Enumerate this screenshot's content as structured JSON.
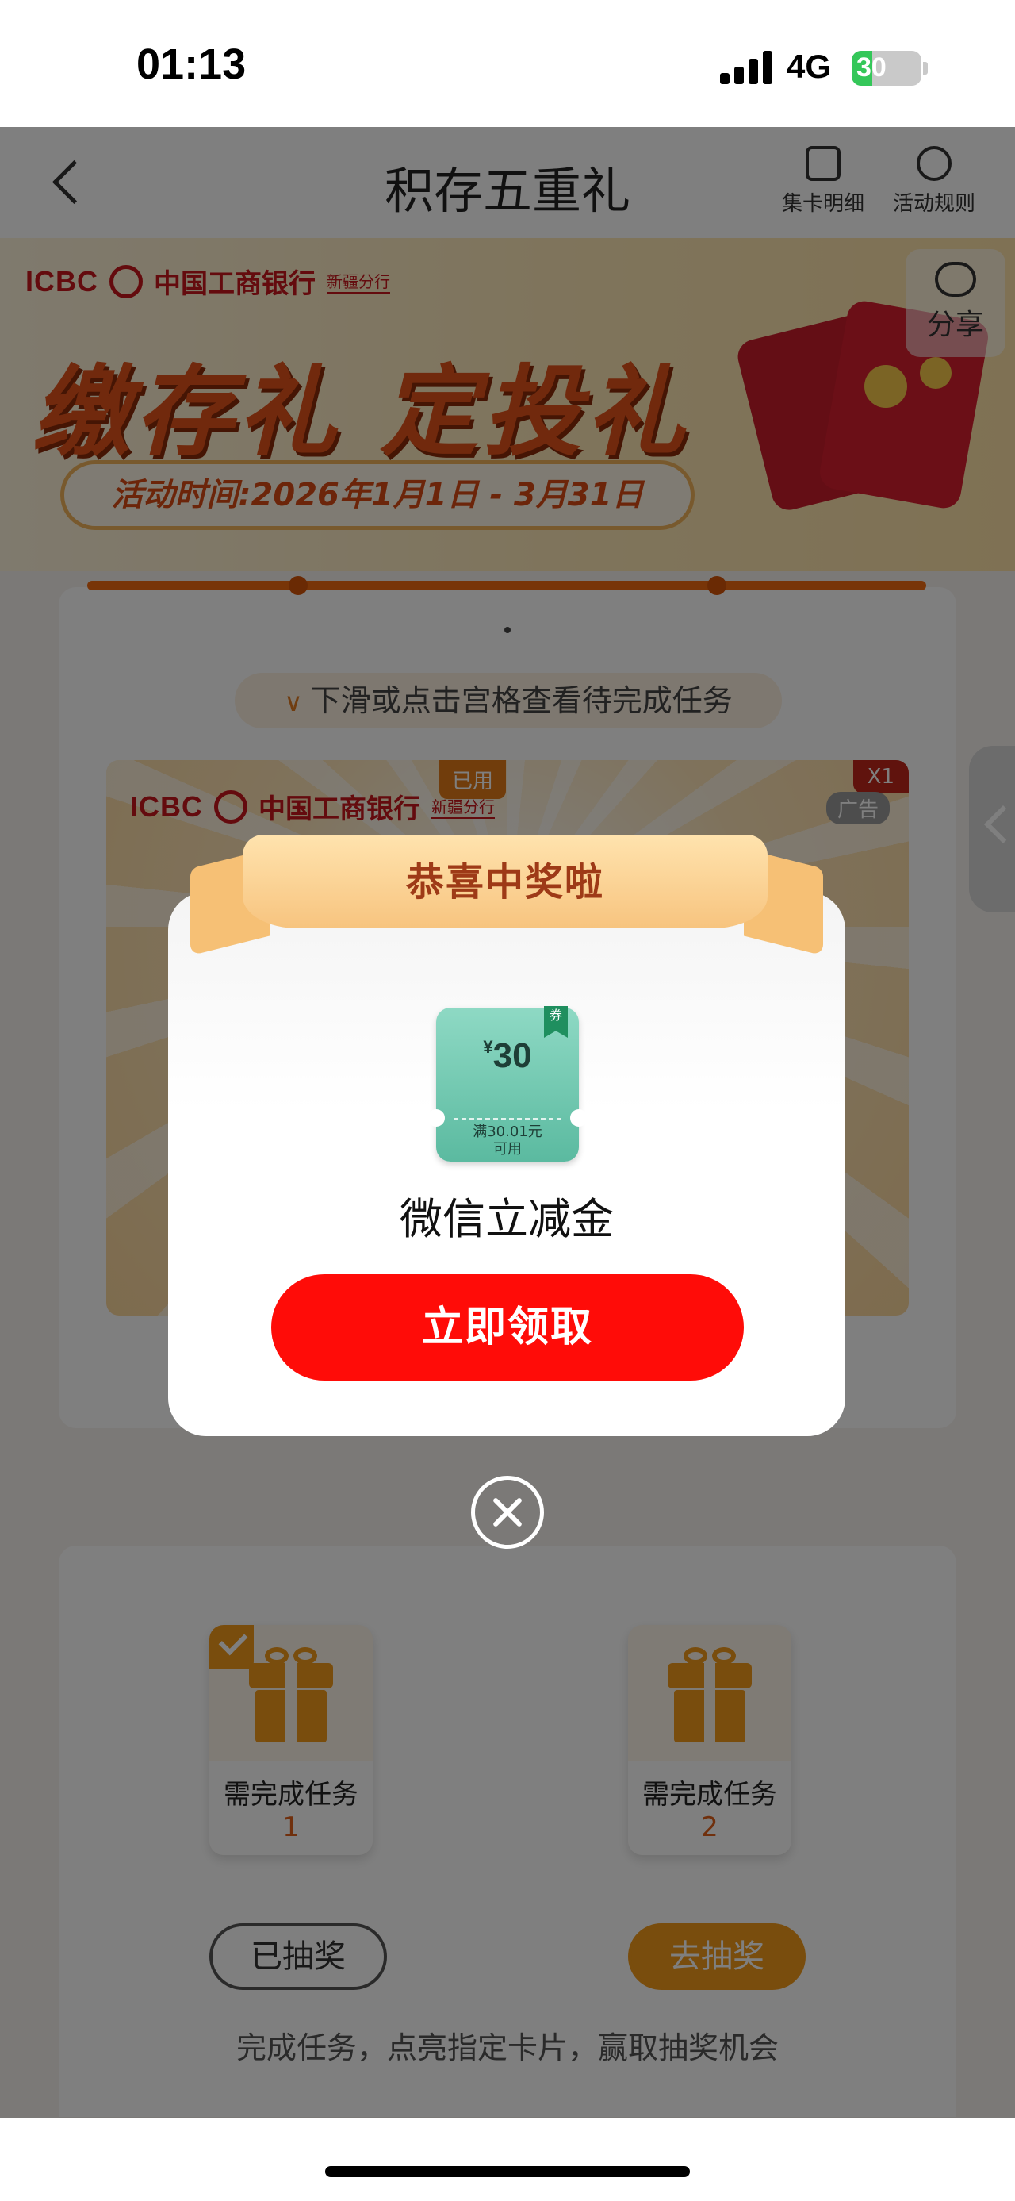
{
  "status_bar": {
    "time": "01:13",
    "network": "4G",
    "battery": "30",
    "battery_level": 0.3
  },
  "nav": {
    "title": "积存五重礼",
    "actions": [
      {
        "label": "集卡明细",
        "icon": "puzzle-icon"
      },
      {
        "label": "活动规则",
        "icon": "info-icon"
      }
    ]
  },
  "banner": {
    "logo_en": "ICBC",
    "logo_cn": "中国工商银行",
    "logo_branch": "新疆分行",
    "headline": "缴存礼 定投礼",
    "date_text": "活动时间:2026年1月1日 - 3月31日",
    "share_label": "分享"
  },
  "lottery_card": {
    "hint": "下滑或点击宫格查看待完成任务",
    "tag_used": "已用",
    "tag_count": "X1",
    "tag_ad": "广告"
  },
  "tasks": {
    "gifts": [
      {
        "label": "需完成任务",
        "count": "1",
        "completed": true
      },
      {
        "label": "需完成任务",
        "count": "2",
        "completed": false
      }
    ],
    "buttons": [
      {
        "label": "已抽奖",
        "state": "done"
      },
      {
        "label": "去抽奖",
        "state": "active"
      }
    ],
    "footnote": "完成任务，点亮指定卡片，赢取抽奖机会"
  },
  "modal": {
    "banner_title": "恭喜中奖啦",
    "coupon": {
      "currency": "¥",
      "value": "30",
      "condition_line1": "满30.01元",
      "condition_line2": "可用",
      "flag": "券"
    },
    "prize_name": "微信立减金",
    "claim_label": "立即领取"
  },
  "colors": {
    "claim_button": "#ff0c08",
    "ribbon": "#f7c47f",
    "coupon": "#5bbaa0",
    "accent_orange": "#f29a1a",
    "icbc_red": "#c8161d"
  }
}
